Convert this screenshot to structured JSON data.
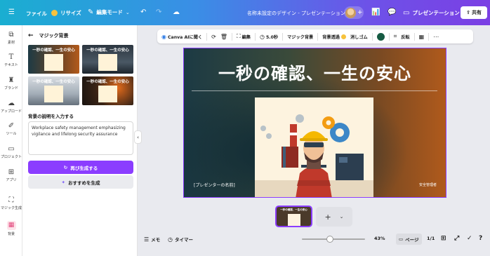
{
  "topbar": {
    "menu_icon": "hamburger-icon",
    "file_label": "ファイル",
    "resize_label": "リサイズ",
    "edit_mode_label": "編集モード",
    "doc_title": "名称未設定のデザイン - プレゼンテーション",
    "present_label": "プレゼンテーション",
    "share_label": "共有",
    "brand_colors": {
      "start": "#1aaed1",
      "end": "#7b3fe4"
    }
  },
  "rail": {
    "items": [
      {
        "label": "素材",
        "icon": "shapes-icon"
      },
      {
        "label": "テキスト",
        "icon": "text-icon"
      },
      {
        "label": "ブランド",
        "icon": "brand-icon"
      },
      {
        "label": "アップロード",
        "icon": "upload-icon"
      },
      {
        "label": "ツール",
        "icon": "draw-icon"
      },
      {
        "label": "プロジェクト",
        "icon": "folder-icon"
      },
      {
        "label": "アプリ",
        "icon": "apps-icon"
      },
      {
        "label": "マジック生成",
        "icon": "magic-media-icon"
      },
      {
        "label": "背景",
        "icon": "background-icon"
      }
    ]
  },
  "panel": {
    "title": "マジック背景",
    "thumb_title": "一秒の確認、一生の安心",
    "description_heading": "背景の説明を入力する",
    "description_value": "Workplace safety management emphasizing vigilance and lifelong security assurance",
    "regenerate_label": "再び生成する",
    "recommend_label": "おすすめを生成"
  },
  "context_toolbar": {
    "canva_ai_label": "Canva AIに聞く",
    "edit_label": "編集",
    "duration_label": "5.0秒",
    "magic_bg_label": "マジック背景",
    "bg_transparent_label": "背景透過",
    "eraser_label": "消しゴム",
    "flip_label": "反転",
    "swatch_color": "#165b43"
  },
  "canvas": {
    "title": "一秒の確認、一生の安心",
    "presenter": "[プレゼンターの名前]",
    "manager": "安全管理者",
    "accent": "#8b3dff"
  },
  "bottom": {
    "notes_label": "メモ",
    "timer_label": "タイマー",
    "zoom": "43%",
    "page_label": "ページ",
    "page_count": "1/1"
  }
}
